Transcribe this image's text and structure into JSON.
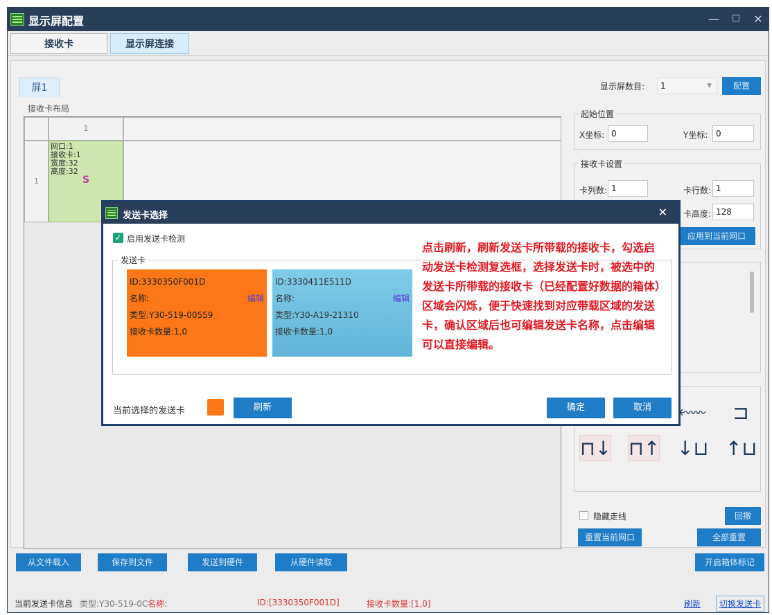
{
  "window": {
    "title": "显示屏配置",
    "minimize_glyph": "—",
    "maximize_glyph": "☐",
    "close_glyph": "✕"
  },
  "tabs": [
    {
      "label": "接收卡",
      "active": false
    },
    {
      "label": "显示屏连接",
      "active": true
    }
  ],
  "screen_tab": "屏1",
  "layout_label": "接收卡布局",
  "grid": {
    "col_header": "1",
    "row_header": "1",
    "cell": {
      "port": "网口:1",
      "card": "接收卡:1",
      "width": "宽度:32",
      "height": "高度:32",
      "marker": "S"
    }
  },
  "right": {
    "screen_count_label": "显示屏数目:",
    "screen_count_value": "1",
    "config_button": "配置",
    "start_pos_title": "起始位置",
    "x_label": "X坐标:",
    "x_value": "0",
    "y_label": "Y坐标:",
    "y_value": "0",
    "card_settings_title": "接收卡设置",
    "cols_label": "卡列数:",
    "cols_value": "1",
    "rows_label": "卡行数:",
    "rows_value": "1",
    "card_height_label": "卡高度:",
    "card_height_value": "128",
    "apply_button": "应用到当前网口",
    "hide_lines_label": "隐藏走线",
    "undo_button": "回撤",
    "reset_port_button": "重置当前网口",
    "reset_all_button": "全部重置",
    "wiring_icons": [
      "⬳",
      "⊐",
      "⊓↓",
      "⊓↑",
      "↓⊔",
      "↑⊔"
    ]
  },
  "bottom_buttons": [
    "从文件载入",
    "保存到文件",
    "发送到硬件",
    "从硬件读取"
  ],
  "cabinet_mark_button": "开启箱体标记",
  "status": {
    "info_label": "当前发送卡信息",
    "type_text": "类型:Y30-519-0C",
    "name_text": "名称:",
    "id_text": "ID:[3330350F001D]",
    "count_text": "接收卡数量:[1,0]",
    "refresh_link": "刷新",
    "switch_link": "切换发送卡"
  },
  "dialog": {
    "title": "发送卡选择",
    "close_glyph": "✕",
    "enable_check_label": "启用发送卡检测",
    "enable_checked": true,
    "group_title": "发送卡",
    "cards": [
      {
        "id": "ID:3330350F001D",
        "name": "名称:",
        "edit": "编辑",
        "type": "类型:Y30-519-00559",
        "count": "接收卡数量:1,0",
        "color": "#fb7718"
      },
      {
        "id": "ID:3330411E511D",
        "name": "名称:",
        "edit": "编辑",
        "type": "类型:Y30-A19-21310",
        "count": "接收卡数量:1,0",
        "color": "#6dc0e0"
      }
    ],
    "annotation": "点击刷新，刷新发送卡所带载的接收卡，勾选启动发送卡检测复选框，选择发送卡时，被选中的发送卡所带载的接收卡（已经配置好数据的箱体）区域会闪烁，便于快速找到对应带载区域的发送卡，确认区域后也可编辑发送卡名称，点击编辑可以直接编辑。",
    "current_label": "当前选择的发送卡",
    "current_color": "#fb7718",
    "refresh_button": "刷新",
    "ok_button": "确定",
    "cancel_button": "取消"
  }
}
